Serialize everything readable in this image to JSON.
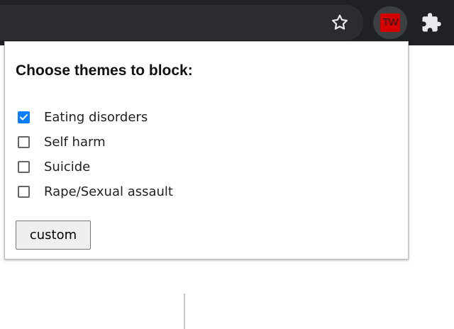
{
  "toolbar": {
    "bookmark_icon": "star-icon",
    "extension_icon": "tw-icon",
    "extension_label": "TW",
    "extensions_menu_icon": "puzzle-icon",
    "colors": {
      "toolbar_bg": "#202124",
      "extension_red": "#d60000"
    }
  },
  "popup": {
    "title": "Choose themes to block:",
    "themes": [
      {
        "label": "Eating disorders",
        "checked": true
      },
      {
        "label": "Self harm",
        "checked": false
      },
      {
        "label": "Suicide",
        "checked": false
      },
      {
        "label": "Rape/Sexual assault",
        "checked": false
      }
    ],
    "custom_button_label": "custom",
    "colors": {
      "checkbox_accent": "#0b7dff"
    }
  }
}
